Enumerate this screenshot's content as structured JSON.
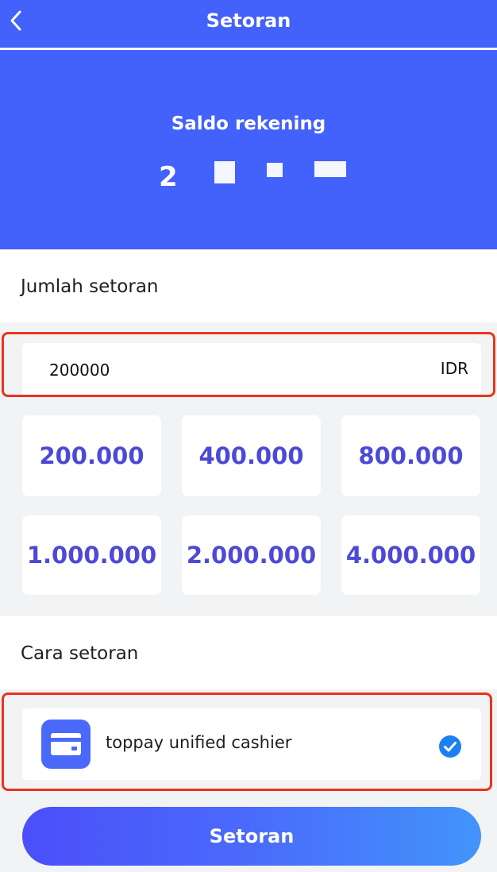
{
  "header": {
    "title": "Setoran"
  },
  "balance": {
    "label": "Saldo rekening",
    "amount_partial": "2        "
  },
  "deposit_amount": {
    "section_title": "Jumlah setoran",
    "input_value": "200000",
    "currency": "IDR",
    "presets": [
      "200.000",
      "400.000",
      "800.000",
      "1.000.000",
      "2.000.000",
      "4.000.000"
    ]
  },
  "deposit_method": {
    "section_title": "Cara setoran",
    "selected_method": "toppay unified cashier"
  },
  "submit": {
    "label": "Setoran"
  },
  "colors": {
    "primary": "#4361fb",
    "preset_text": "#4c49d8",
    "highlight": "#e8341d",
    "check": "#1e7ff0"
  }
}
